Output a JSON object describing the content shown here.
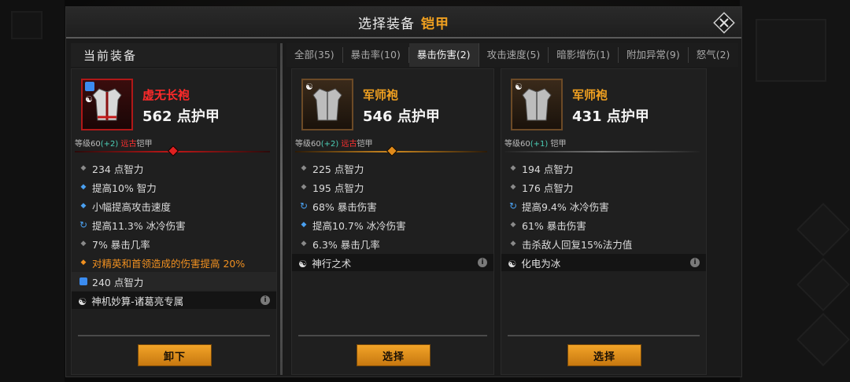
{
  "title": {
    "main": "选择装备",
    "accent": "铠甲"
  },
  "current_section_label": "当前装备",
  "tabs": [
    {
      "label": "全部(35)",
      "active": false
    },
    {
      "label": "暴击率(10)",
      "active": false
    },
    {
      "label": "暴击伤害(2)",
      "active": true
    },
    {
      "label": "攻击速度(5)",
      "active": false
    },
    {
      "label": "暗影增伤(1)",
      "active": false
    },
    {
      "label": "附加异常(9)",
      "active": false
    },
    {
      "label": "怒气(2)",
      "active": false
    }
  ],
  "current_item": {
    "name": "虚无长袍",
    "armor": "562 点护甲",
    "level_prefix": "等级60",
    "level_bonus": "(+2)",
    "level_tag": "远古",
    "level_suffix": "铠甲",
    "stats": [
      {
        "bullet": "grey",
        "text": "234 点智力"
      },
      {
        "bullet": "blue",
        "text": "提高10% 智力"
      },
      {
        "bullet": "blue",
        "text": "小幅提高攻击速度"
      },
      {
        "bullet": "cycle",
        "text": "提高11.3% 冰冷伤害"
      },
      {
        "bullet": "grey",
        "text": "7% 暴击几率"
      },
      {
        "bullet": "orange",
        "text": "对精英和首领造成的伤害提高 20%"
      },
      {
        "bullet": "gem",
        "text": "240 点智力"
      }
    ],
    "skill": "神机妙算-诸葛亮专属",
    "button": "卸下"
  },
  "candidates": [
    {
      "name": "军师袍",
      "armor": "546 点护甲",
      "level_prefix": "等级60",
      "level_bonus": "(+2)",
      "level_tag": "远古",
      "level_suffix": "铠甲",
      "stats": [
        {
          "bullet": "grey",
          "text": "225 点智力"
        },
        {
          "bullet": "grey",
          "text": "195 点智力"
        },
        {
          "bullet": "cycle",
          "text": "68% 暴击伤害"
        },
        {
          "bullet": "blue",
          "text": "提高10.7% 冰冷伤害"
        },
        {
          "bullet": "grey",
          "text": "6.3% 暴击几率"
        }
      ],
      "skill": "神行之术",
      "button": "选择"
    },
    {
      "name": "军师袍",
      "armor": "431 点护甲",
      "level_prefix": "等级60",
      "level_bonus": "(+1)",
      "level_tag": "",
      "level_suffix": "铠甲",
      "stats": [
        {
          "bullet": "grey",
          "text": "194 点智力"
        },
        {
          "bullet": "grey",
          "text": "176 点智力"
        },
        {
          "bullet": "cycle",
          "text": "提高9.4% 冰冷伤害"
        },
        {
          "bullet": "grey",
          "text": "61% 暴击伤害"
        },
        {
          "bullet": "grey",
          "text": "击杀敌人回复15%法力值"
        }
      ],
      "skill": "化电为冰",
      "button": "选择"
    }
  ],
  "colors": {
    "accent": "#f0a020",
    "legendary_red": "#ff2a2a",
    "bonus_teal": "#4cd0b8",
    "button": "#e08f1a"
  }
}
